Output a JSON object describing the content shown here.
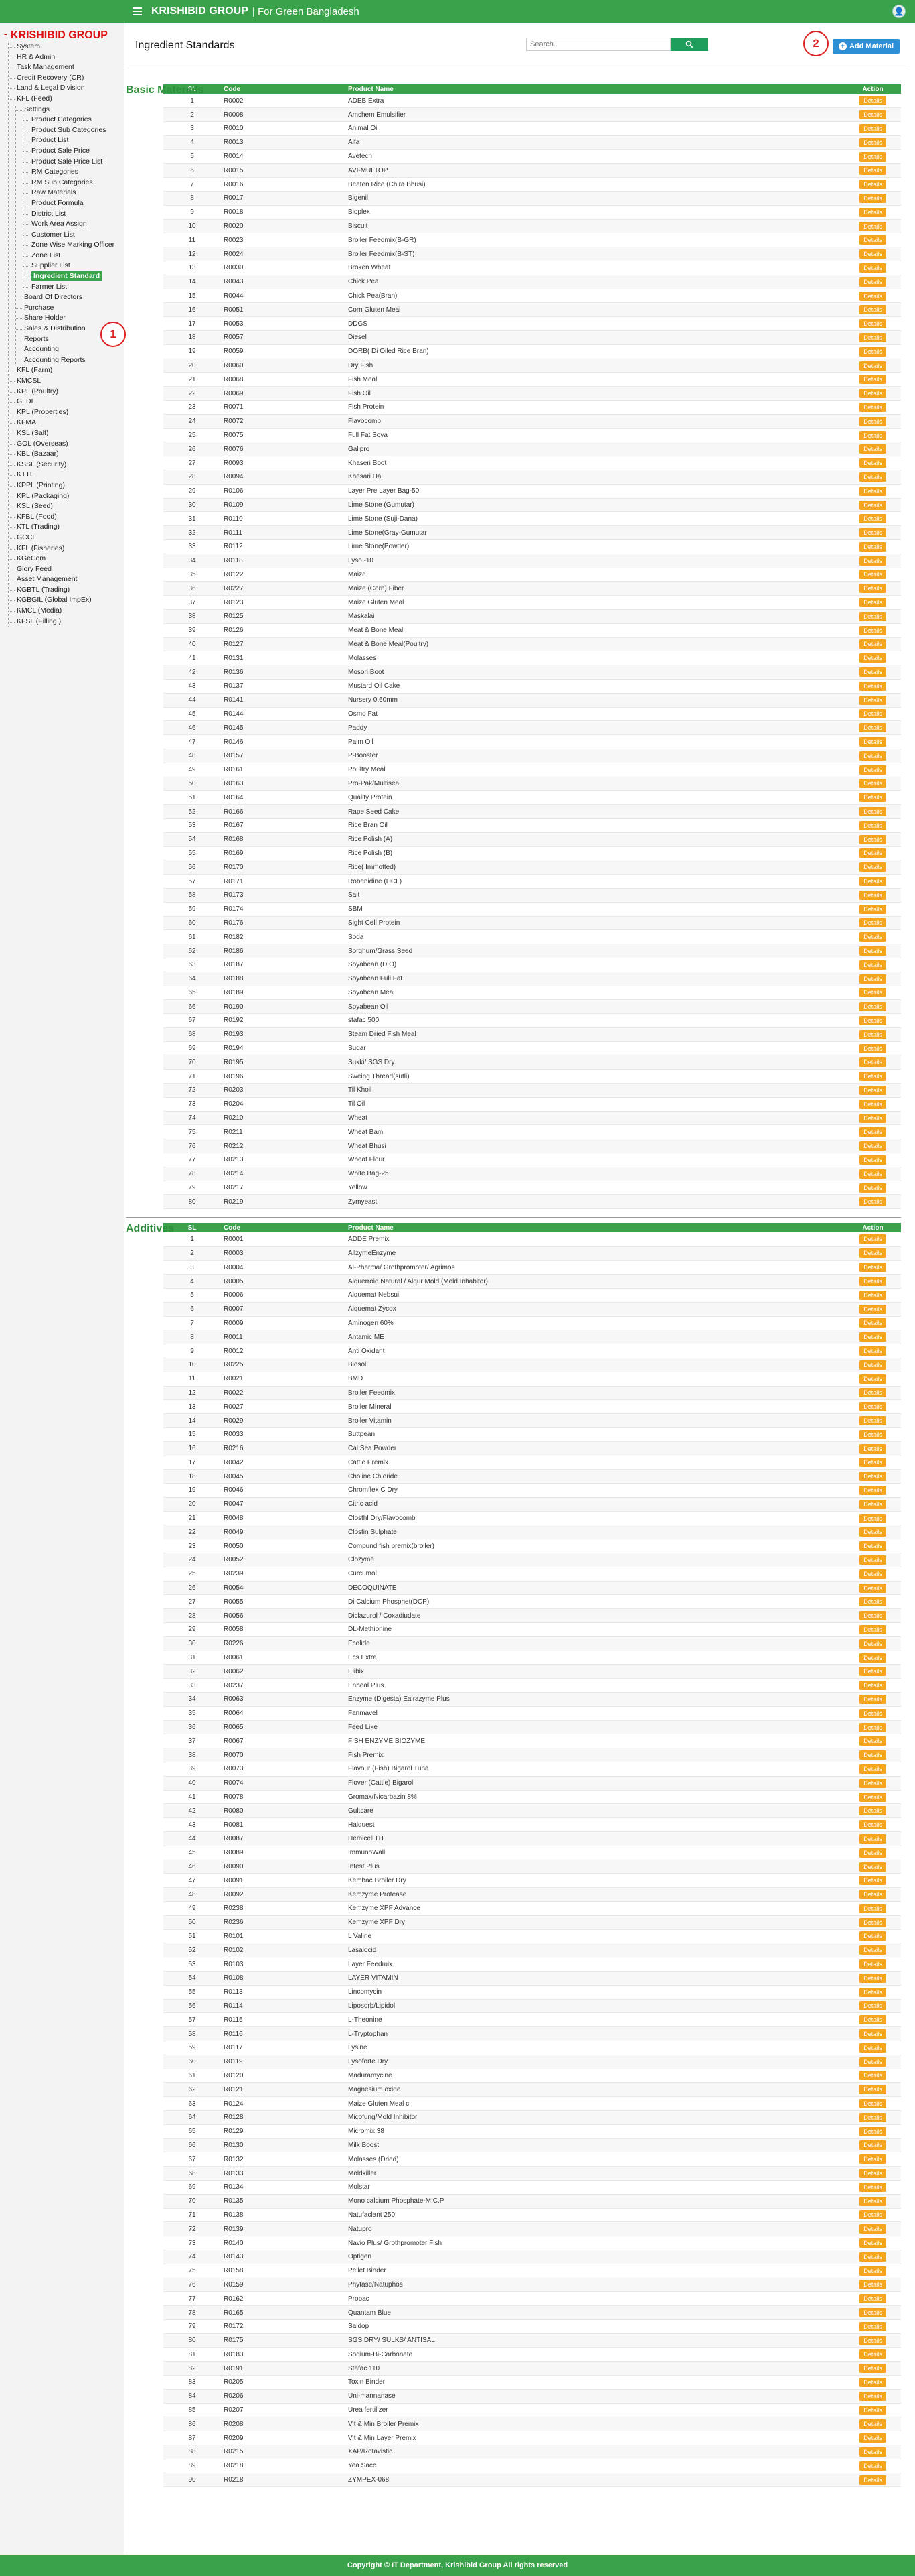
{
  "topbar": {
    "brand": "KRISHIBID GROUP",
    "tagline": "| For Green Bangladesh"
  },
  "sidebar": {
    "title": "KRISHIBID GROUP",
    "items": [
      {
        "label": "System",
        "level": 1
      },
      {
        "label": "HR & Admin",
        "level": 1
      },
      {
        "label": "Task Management",
        "level": 1
      },
      {
        "label": "Credit Recovery (CR)",
        "level": 1
      },
      {
        "label": "Land & Legal Division",
        "level": 1
      },
      {
        "label": "KFL (Feed)",
        "level": 1
      },
      {
        "label": "Settings",
        "level": 2
      },
      {
        "label": "Product Categories",
        "level": 3
      },
      {
        "label": "Product Sub Categories",
        "level": 3
      },
      {
        "label": "Product List",
        "level": 3
      },
      {
        "label": "Product Sale Price",
        "level": 3
      },
      {
        "label": "Product Sale Price List",
        "level": 3
      },
      {
        "label": "RM Categories",
        "level": 3
      },
      {
        "label": "RM Sub Categories",
        "level": 3
      },
      {
        "label": "Raw Materials",
        "level": 3
      },
      {
        "label": "Product Formula",
        "level": 3
      },
      {
        "label": "District List",
        "level": 3
      },
      {
        "label": "Work Area Assign",
        "level": 3
      },
      {
        "label": "Customer List",
        "level": 3
      },
      {
        "label": "Zone Wise Marking Officer",
        "level": 3
      },
      {
        "label": "Zone List",
        "level": 3
      },
      {
        "label": "Supplier List",
        "level": 3
      },
      {
        "label": "Ingredient Standard",
        "level": 3,
        "active": true
      },
      {
        "label": "Farmer List",
        "level": 3
      },
      {
        "label": "Board Of Directors",
        "level": 2
      },
      {
        "label": "Purchase",
        "level": 2
      },
      {
        "label": "Share Holder",
        "level": 2
      },
      {
        "label": "Sales & Distribution",
        "level": 2
      },
      {
        "label": "Reports",
        "level": 2
      },
      {
        "label": "Accounting",
        "level": 2
      },
      {
        "label": "Accounting Reports",
        "level": 2
      },
      {
        "label": "KFL (Farm)",
        "level": 1
      },
      {
        "label": "KMCSL",
        "level": 1
      },
      {
        "label": "KPL (Poultry)",
        "level": 1
      },
      {
        "label": "GLDL",
        "level": 1
      },
      {
        "label": "KPL (Properties)",
        "level": 1
      },
      {
        "label": "KFMAL",
        "level": 1
      },
      {
        "label": "KSL (Salt)",
        "level": 1
      },
      {
        "label": "GOL (Overseas)",
        "level": 1
      },
      {
        "label": "KBL (Bazaar)",
        "level": 1
      },
      {
        "label": "KSSL (Security)",
        "level": 1
      },
      {
        "label": "KTTL",
        "level": 1
      },
      {
        "label": "KPPL (Printing)",
        "level": 1
      },
      {
        "label": "KPL (Packaging)",
        "level": 1
      },
      {
        "label": "KSL (Seed)",
        "level": 1
      },
      {
        "label": "KFBL (Food)",
        "level": 1
      },
      {
        "label": "KTL (Trading)",
        "level": 1
      },
      {
        "label": "GCCL",
        "level": 1
      },
      {
        "label": "KFL (Fisheries)",
        "level": 1
      },
      {
        "label": "KGeCom",
        "level": 1
      },
      {
        "label": "Glory Feed",
        "level": 1
      },
      {
        "label": "Asset Management",
        "level": 1
      },
      {
        "label": "KGBTL (Trading)",
        "level": 1
      },
      {
        "label": "KGBGIL (Global ImpEx)",
        "level": 1
      },
      {
        "label": "KMCL (Media)",
        "level": 1
      },
      {
        "label": "KFSL (Filling )",
        "level": 1
      }
    ]
  },
  "markers": [
    "1",
    "2"
  ],
  "page": {
    "title": "Ingredient Standards",
    "search_placeholder": "Search..",
    "add_label": "Add Material"
  },
  "table_headers": {
    "sl": "SL",
    "code": "Code",
    "name": "Product Name",
    "action": "Action"
  },
  "details_label": "Details",
  "basic": {
    "title": "Basic Materials",
    "rows": [
      [
        "R0002",
        "ADEB Extra"
      ],
      [
        "R0008",
        "Amchem Emulsifier"
      ],
      [
        "R0010",
        "Animal Oil"
      ],
      [
        "R0013",
        "Alfa"
      ],
      [
        "R0014",
        "Avetech"
      ],
      [
        "R0015",
        "AVI-MULTOP"
      ],
      [
        "R0016",
        "Beaten Rice (Chira Bhusi)"
      ],
      [
        "R0017",
        "Bigenil"
      ],
      [
        "R0018",
        "Bioplex"
      ],
      [
        "R0020",
        "Biscuit"
      ],
      [
        "R0023",
        "Broiler Feedmix(B-GR)"
      ],
      [
        "R0024",
        "Broiler Feedmix(B-ST)"
      ],
      [
        "R0030",
        "Broken Wheat"
      ],
      [
        "R0043",
        "Chick Pea"
      ],
      [
        "R0044",
        "Chick Pea(Bran)"
      ],
      [
        "R0051",
        "Corn Gluten Meal"
      ],
      [
        "R0053",
        "DDGS"
      ],
      [
        "R0057",
        "Diesel"
      ],
      [
        "R0059",
        "DORB( Di Oiled Rice Bran)"
      ],
      [
        "R0060",
        "Dry Fish"
      ],
      [
        "R0068",
        "Fish Meal"
      ],
      [
        "R0069",
        "Fish Oil"
      ],
      [
        "R0071",
        "Fish Protein"
      ],
      [
        "R0072",
        "Flavocomb"
      ],
      [
        "R0075",
        "Full Fat Soya"
      ],
      [
        "R0076",
        "Galipro"
      ],
      [
        "R0093",
        "Khaseri Boot"
      ],
      [
        "R0094",
        "Khesari Dal"
      ],
      [
        "R0106",
        "Layer Pre Layer Bag-50"
      ],
      [
        "R0109",
        "Lime Stone (Gumutar)"
      ],
      [
        "R0110",
        "Lime Stone (Suji-Dana)"
      ],
      [
        "R0111",
        "Lime Stone(Gray-Gumutar"
      ],
      [
        "R0112",
        "Lime Stone(Powder)"
      ],
      [
        "R0118",
        "Lyso -10"
      ],
      [
        "R0122",
        "Maize"
      ],
      [
        "R0227",
        "Maize (Corn) Fiber"
      ],
      [
        "R0123",
        "Maize Gluten Meal"
      ],
      [
        "R0125",
        "Maskalai"
      ],
      [
        "R0126",
        "Meat & Bone Meal"
      ],
      [
        "R0127",
        "Meat & Bone Meal(Poultry)"
      ],
      [
        "R0131",
        "Molasses"
      ],
      [
        "R0136",
        "Mosori Boot"
      ],
      [
        "R0137",
        "Mustard Oil Cake"
      ],
      [
        "R0141",
        "Nursery 0.60mm"
      ],
      [
        "R0144",
        "Osmo Fat"
      ],
      [
        "R0145",
        "Paddy"
      ],
      [
        "R0146",
        "Palm Oil"
      ],
      [
        "R0157",
        "P-Booster"
      ],
      [
        "R0161",
        "Poultry Meal"
      ],
      [
        "R0163",
        "Pro-Pak/Multisea"
      ],
      [
        "R0164",
        "Quality Protein"
      ],
      [
        "R0166",
        "Rape Seed Cake"
      ],
      [
        "R0167",
        "Rice Bran Oil"
      ],
      [
        "R0168",
        "Rice Polish (A)"
      ],
      [
        "R0169",
        "Rice Polish (B)"
      ],
      [
        "R0170",
        "Rice( Immotted)"
      ],
      [
        "R0171",
        "Robenidine (HCL)"
      ],
      [
        "R0173",
        "Salt"
      ],
      [
        "R0174",
        "SBM"
      ],
      [
        "R0176",
        "Sight Cell Protein"
      ],
      [
        "R0182",
        "Soda"
      ],
      [
        "R0186",
        "Sorghum/Grass Seed"
      ],
      [
        "R0187",
        "Soyabean (D.O)"
      ],
      [
        "R0188",
        "Soyabean Full Fat"
      ],
      [
        "R0189",
        "Soyabean Meal"
      ],
      [
        "R0190",
        "Soyabean Oil"
      ],
      [
        "R0192",
        "stafac 500"
      ],
      [
        "R0193",
        "Steam Dried Fish Meal"
      ],
      [
        "R0194",
        "Sugar"
      ],
      [
        "R0195",
        "Sukki/ SGS Dry"
      ],
      [
        "R0196",
        "Sweing Thread(sutli)"
      ],
      [
        "R0203",
        "Til Khoil"
      ],
      [
        "R0204",
        "Til Oil"
      ],
      [
        "R0210",
        "Wheat"
      ],
      [
        "R0211",
        "Wheat Bam"
      ],
      [
        "R0212",
        "Wheat Bhusi"
      ],
      [
        "R0213",
        "Wheat Flour"
      ],
      [
        "R0214",
        "White Bag-25"
      ],
      [
        "R0217",
        "Yellow"
      ],
      [
        "R0219",
        "Zymyeast"
      ]
    ]
  },
  "additives": {
    "title": "Additives",
    "rows": [
      [
        "R0001",
        "ADDE Premix"
      ],
      [
        "R0003",
        "AllzymeEnzyme"
      ],
      [
        "R0004",
        "Al-Pharma/ Grothpromoter/ Agrimos"
      ],
      [
        "R0005",
        "Alquerroid Natural / Alqur Mold (Mold Inhabitor)"
      ],
      [
        "R0006",
        "Alquemat Nebsui"
      ],
      [
        "R0007",
        "Alquemat Zycox"
      ],
      [
        "R0009",
        "Aminogen 60%"
      ],
      [
        "R0011",
        "Antamic ME"
      ],
      [
        "R0012",
        "Anti Oxidant"
      ],
      [
        "R0225",
        "Biosol"
      ],
      [
        "R0021",
        "BMD"
      ],
      [
        "R0022",
        "Broiler Feedmix"
      ],
      [
        "R0027",
        "Broiler Mineral"
      ],
      [
        "R0029",
        "Broiler Vitamin"
      ],
      [
        "R0033",
        "Buttpean"
      ],
      [
        "R0216",
        "Cal Sea Powder"
      ],
      [
        "R0042",
        "Cattle Premix"
      ],
      [
        "R0045",
        "Choline Chloride"
      ],
      [
        "R0046",
        "Chromflex C Dry"
      ],
      [
        "R0047",
        "Citric acid"
      ],
      [
        "R0048",
        "Closthl Dry/Flavocomb"
      ],
      [
        "R0049",
        "Clostin Sulphate"
      ],
      [
        "R0050",
        "Compund fish premix(broiler)"
      ],
      [
        "R0052",
        "Clozyme"
      ],
      [
        "R0239",
        "Curcumol"
      ],
      [
        "R0054",
        "DECOQUINATE"
      ],
      [
        "R0055",
        "Di Calcium Phosphet(DCP)"
      ],
      [
        "R0056",
        "Diclazurol / Coxadiudate"
      ],
      [
        "R0058",
        "DL-Methionine"
      ],
      [
        "R0226",
        "Ecolide"
      ],
      [
        "R0061",
        "Ecs Extra"
      ],
      [
        "R0062",
        "Elibix"
      ],
      [
        "R0237",
        "Enbeal Plus"
      ],
      [
        "R0063",
        "Enzyme (Digesta) Ealrazyme Plus"
      ],
      [
        "R0064",
        "Fanmavel"
      ],
      [
        "R0065",
        "Feed Like"
      ],
      [
        "R0067",
        "FISH ENZYME BIOZYME"
      ],
      [
        "R0070",
        "Fish Premix"
      ],
      [
        "R0073",
        "Flavour (Fish) Bigarol Tuna"
      ],
      [
        "R0074",
        "Flover (Cattle) Bigarol"
      ],
      [
        "R0078",
        "Gromax/Nicarbazin 8%"
      ],
      [
        "R0080",
        "Gultcare"
      ],
      [
        "R0081",
        "Halquest"
      ],
      [
        "R0087",
        "Hemicell HT"
      ],
      [
        "R0089",
        "ImmunoWall"
      ],
      [
        "R0090",
        "Intest Plus"
      ],
      [
        "R0091",
        "Kembac Broiler Dry"
      ],
      [
        "R0092",
        "Kemzyme Protease"
      ],
      [
        "R0238",
        "Kemzyme XPF Advance"
      ],
      [
        "R0236",
        "Kemzyme XPF Dry"
      ],
      [
        "R0101",
        "L Valine"
      ],
      [
        "R0102",
        "Lasalocid"
      ],
      [
        "R0103",
        "Layer Feedmix"
      ],
      [
        "R0108",
        "LAYER VITAMIN"
      ],
      [
        "R0113",
        "Lincomycin"
      ],
      [
        "R0114",
        "Liposorb/Lipidol"
      ],
      [
        "R0115",
        "L-Theonine"
      ],
      [
        "R0116",
        "L-Tryptophan"
      ],
      [
        "R0117",
        "Lysine"
      ],
      [
        "R0119",
        "Lysoforte Dry"
      ],
      [
        "R0120",
        "Maduramycine"
      ],
      [
        "R0121",
        "Magnesium oxide"
      ],
      [
        "R0124",
        "Maize Gluten Meal c"
      ],
      [
        "R0128",
        "Micofung/Mold Inhibitor"
      ],
      [
        "R0129",
        "Micromix 38"
      ],
      [
        "R0130",
        "Milk Boost"
      ],
      [
        "R0132",
        "Molasses (Dried)"
      ],
      [
        "R0133",
        "Moldkiller"
      ],
      [
        "R0134",
        "Molstar"
      ],
      [
        "R0135",
        "Mono calcium Phosphate-M.C.P"
      ],
      [
        "R0138",
        "Natufaclant 250"
      ],
      [
        "R0139",
        "Natupro"
      ],
      [
        "R0140",
        "Navio Plus/ Grothpromoter Fish"
      ],
      [
        "R0143",
        "Optigen"
      ],
      [
        "R0158",
        "Pellet Binder"
      ],
      [
        "R0159",
        "Phytase/Natuphos"
      ],
      [
        "R0162",
        "Propac"
      ],
      [
        "R0165",
        "Quantam Blue"
      ],
      [
        "R0172",
        "Saldop"
      ],
      [
        "R0175",
        "SGS DRY/ SULKS/ ANTISAL"
      ],
      [
        "R0183",
        "Sodium-Bi-Carbonate"
      ],
      [
        "R0191",
        "Stafac 110"
      ],
      [
        "R0205",
        "Toxin Binder"
      ],
      [
        "R0206",
        "Uni-mannanase"
      ],
      [
        "R0207",
        "Urea fertilizer"
      ],
      [
        "R0208",
        "Vit & Min Broiler Premix"
      ],
      [
        "R0209",
        "Vit & Min Layer Premix"
      ],
      [
        "R0215",
        "XAP/Rotavistic"
      ],
      [
        "R0218",
        "Yea Sacc"
      ],
      [
        "R0218",
        "ZYMPEX-068"
      ]
    ]
  },
  "footer": "Copyright © IT Department, Krishibid Group All rights reserved"
}
